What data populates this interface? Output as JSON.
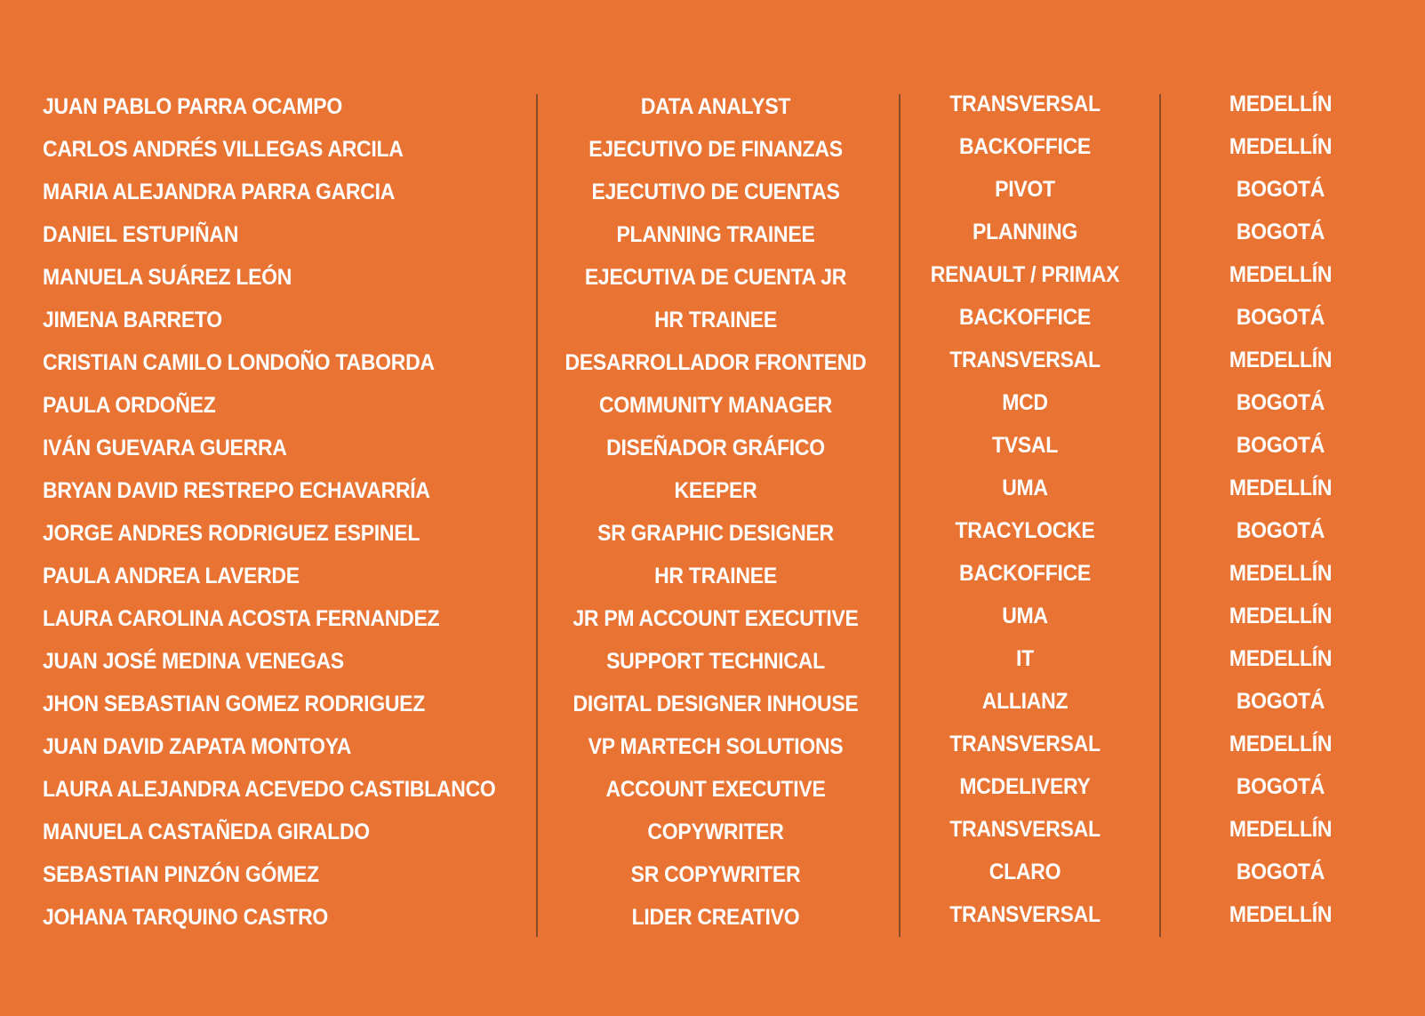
{
  "roster": [
    {
      "name": "JUAN PABLO PARRA OCAMPO",
      "role": "DATA ANALYST",
      "team": "TRANSVERSAL",
      "city": "MEDELLÍN"
    },
    {
      "name": "CARLOS ANDRÉS VILLEGAS ARCILA",
      "role": "EJECUTIVO DE FINANZAS",
      "team": "BACKOFFICE",
      "city": "MEDELLÍN"
    },
    {
      "name": "MARIA ALEJANDRA PARRA GARCIA",
      "role": "EJECUTIVO DE CUENTAS",
      "team": "PIVOT",
      "city": "BOGOTÁ"
    },
    {
      "name": "DANIEL ESTUPIÑAN",
      "role": "PLANNING TRAINEE",
      "team": "PLANNING",
      "city": "BOGOTÁ"
    },
    {
      "name": "MANUELA SUÁREZ LEÓN",
      "role": "EJECUTIVA DE CUENTA JR",
      "team": "RENAULT / PRIMAX",
      "city": "MEDELLÍN"
    },
    {
      "name": "JIMENA BARRETO",
      "role": "HR TRAINEE",
      "team": "BACKOFFICE",
      "city": "BOGOTÁ"
    },
    {
      "name": "CRISTIAN CAMILO LONDOÑO TABORDA",
      "role": "DESARROLLADOR FRONTEND",
      "team": "TRANSVERSAL",
      "city": "MEDELLÍN"
    },
    {
      "name": "PAULA ORDOÑEZ",
      "role": "COMMUNITY MANAGER",
      "team": "MCD",
      "city": "BOGOTÁ"
    },
    {
      "name": "IVÁN GUEVARA GUERRA",
      "role": "DISEÑADOR GRÁFICO",
      "team": "TVSAL",
      "city": "BOGOTÁ"
    },
    {
      "name": "BRYAN DAVID RESTREPO ECHAVARRÍA",
      "role": "KEEPER",
      "team": "UMA",
      "city": "MEDELLÍN"
    },
    {
      "name": "JORGE ANDRES RODRIGUEZ ESPINEL",
      "role": "SR GRAPHIC DESIGNER",
      "team": "TRACYLOCKE",
      "city": "BOGOTÁ"
    },
    {
      "name": "PAULA ANDREA LAVERDE",
      "role": "HR TRAINEE",
      "team": "BACKOFFICE",
      "city": "MEDELLÍN"
    },
    {
      "name": "LAURA CAROLINA ACOSTA FERNANDEZ",
      "role": "JR PM ACCOUNT EXECUTIVE",
      "team": "UMA",
      "city": "MEDELLÍN"
    },
    {
      "name": "JUAN JOSÉ MEDINA VENEGAS",
      "role": "SUPPORT TECHNICAL",
      "team": "IT",
      "city": "MEDELLÍN"
    },
    {
      "name": "JHON SEBASTIAN GOMEZ RODRIGUEZ",
      "role": "DIGITAL DESIGNER INHOUSE",
      "team": "ALLIANZ",
      "city": "BOGOTÁ"
    },
    {
      "name": "JUAN DAVID ZAPATA MONTOYA",
      "role": "VP MARTECH SOLUTIONS",
      "team": "TRANSVERSAL",
      "city": "MEDELLÍN"
    },
    {
      "name": "LAURA ALEJANDRA ACEVEDO CASTIBLANCO",
      "role": "ACCOUNT EXECUTIVE",
      "team": "MCDELIVERY",
      "city": "BOGOTÁ"
    },
    {
      "name": "MANUELA CASTAÑEDA GIRALDO",
      "role": "COPYWRITER",
      "team": "TRANSVERSAL",
      "city": "MEDELLÍN"
    },
    {
      "name": "SEBASTIAN PINZÓN GÓMEZ",
      "role": "SR COPYWRITER",
      "team": "CLARO",
      "city": "BOGOTÁ"
    },
    {
      "name": "JOHANA TARQUINO CASTRO",
      "role": "LIDER CREATIVO",
      "team": "TRANSVERSAL",
      "city": "MEDELLÍN"
    }
  ],
  "colors": {
    "background": "#e97332",
    "text": "#ffffff",
    "divider": "#8a4a26"
  }
}
